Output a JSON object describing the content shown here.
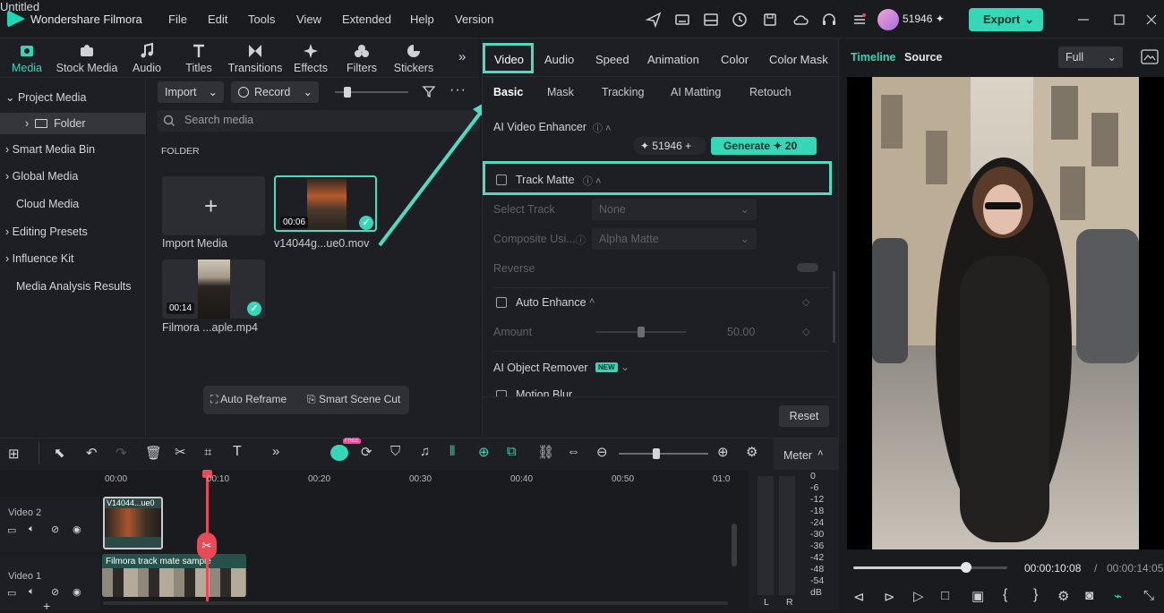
{
  "app": {
    "name": "Wondershare Filmora",
    "menu": [
      "File",
      "Edit",
      "Tools",
      "View",
      "Extended",
      "Help",
      "Version"
    ],
    "document_title": "Untitled",
    "credits": "51946",
    "export_label": "Export"
  },
  "media_tabs": [
    {
      "label": "Media",
      "icon": "media-icon",
      "active": true
    },
    {
      "label": "Stock Media",
      "icon": "stock-media-icon"
    },
    {
      "label": "Audio",
      "icon": "music-note-icon"
    },
    {
      "label": "Titles",
      "icon": "titles-icon"
    },
    {
      "label": "Transitions",
      "icon": "transitions-icon"
    },
    {
      "label": "Effects",
      "icon": "effects-icon"
    },
    {
      "label": "Filters",
      "icon": "filters-icon"
    },
    {
      "label": "Stickers",
      "icon": "stickers-icon"
    }
  ],
  "media_nav": [
    {
      "label": "Project Media",
      "expanded": true
    },
    {
      "label": "Folder",
      "selected": true
    },
    {
      "label": "Smart Media Bin"
    },
    {
      "label": "Global Media"
    },
    {
      "label": "Cloud Media"
    },
    {
      "label": "Editing Presets"
    },
    {
      "label": "Influence Kit"
    },
    {
      "label": "Media Analysis Results"
    }
  ],
  "media_toolbar": {
    "import": "Import",
    "record": "Record"
  },
  "search": {
    "placeholder": "Search media"
  },
  "folder_heading": "FOLDER",
  "media_items": [
    {
      "label": "Import Media"
    },
    {
      "label": "v14044g...ue0.mov",
      "duration": "00:06"
    },
    {
      "label": "Filmora ...aple.mp4",
      "duration": "00:14"
    }
  ],
  "bottom_actions": {
    "auto_reframe": "Auto Reframe",
    "smart_scene_cut": "Smart Scene Cut"
  },
  "prop_tabs": [
    "Video",
    "Audio",
    "Speed",
    "Animation",
    "Color",
    "Color Mask"
  ],
  "prop_subtabs": [
    "Basic",
    "Mask",
    "Tracking",
    "AI Matting",
    "Retouch"
  ],
  "props": {
    "ai_video_enhancer": "AI Video Enhancer",
    "credit_count": "51946",
    "generate_label": "Generate",
    "generate_cost": "20",
    "track_matte": "Track Matte",
    "select_track_label": "Select Track",
    "select_track_value": "None",
    "composite_label": "Composite Usi...",
    "composite_value": "Alpha Matte",
    "reverse_label": "Reverse",
    "auto_enhance": "Auto Enhance",
    "amount_label": "Amount",
    "amount_value": "50.00",
    "amount_fraction": 0.5,
    "ai_object_remover": "AI Object Remover",
    "new_badge": "NEW",
    "motion_blur": "Motion Blur",
    "reset": "Reset"
  },
  "preview": {
    "timeline_tab": "Timeline",
    "source_tab": "Source",
    "quality": "Full",
    "current_time": "00:00:10:08",
    "separator": "/",
    "total_time": "00:00:14:05",
    "progress": 0.73
  },
  "timeline": {
    "ruler": [
      "00:00",
      "00:10",
      "00:20",
      "00:30",
      "00:40",
      "00:50",
      "01:0"
    ],
    "tracks": [
      {
        "name": "Video 2",
        "clip": "V14044...ue0"
      },
      {
        "name": "Video 1",
        "clip": "Filmora track mate sample"
      }
    ],
    "meter_label": "Meter",
    "meter_scale": [
      "0",
      "-6",
      "-12",
      "-18",
      "-24",
      "-30",
      "-36",
      "-42",
      "-48",
      "-54",
      "dB"
    ],
    "meter_channels": [
      "L",
      "R"
    ],
    "free_badge": "FREE"
  },
  "colors": {
    "accent": "#34d8b7",
    "highlight": "#4ddcc0",
    "playhead": "#e84a57"
  }
}
